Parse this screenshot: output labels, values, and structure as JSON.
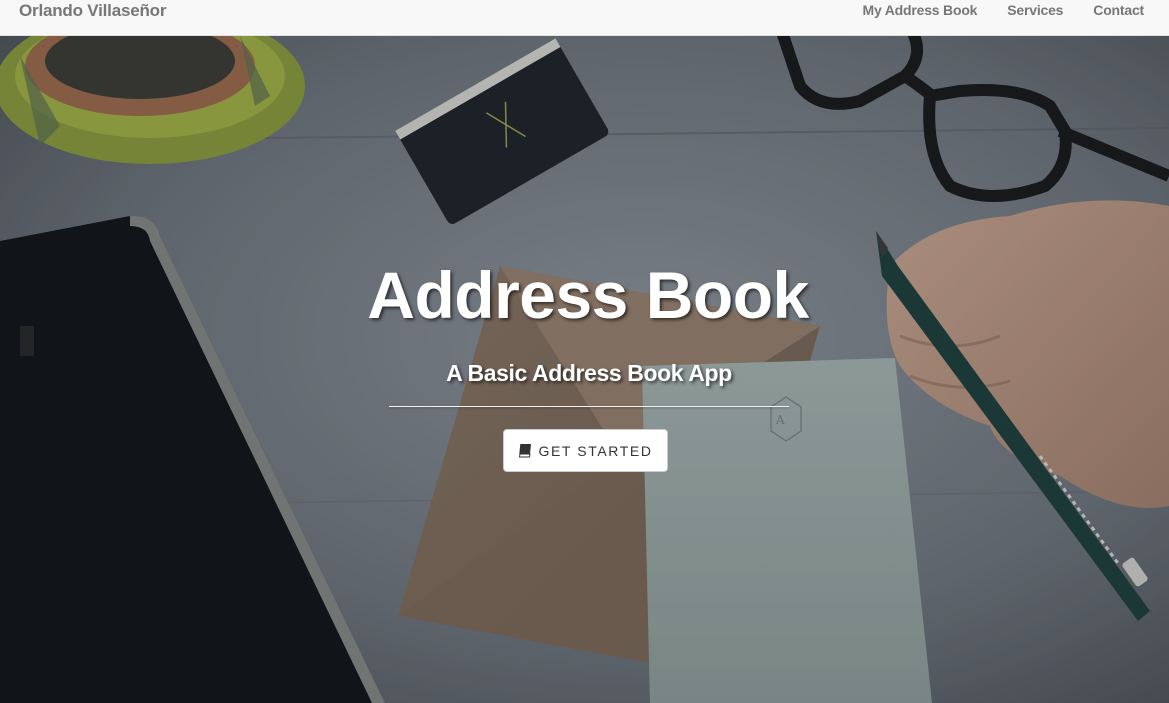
{
  "navbar": {
    "brand": "Orlando Villaseñor",
    "links": [
      {
        "label": "My Address Book"
      },
      {
        "label": "Services"
      },
      {
        "label": "Contact"
      }
    ]
  },
  "hero": {
    "title": "Address Book",
    "subtitle": "A Basic Address Book App",
    "button": {
      "label": "GET STARTED",
      "icon": "book-icon"
    }
  },
  "colors": {
    "navbar_bg": "#f8f8f8",
    "nav_text": "#777777",
    "hero_text": "#ffffff",
    "button_bg": "#ffffff",
    "button_text": "#333333"
  }
}
